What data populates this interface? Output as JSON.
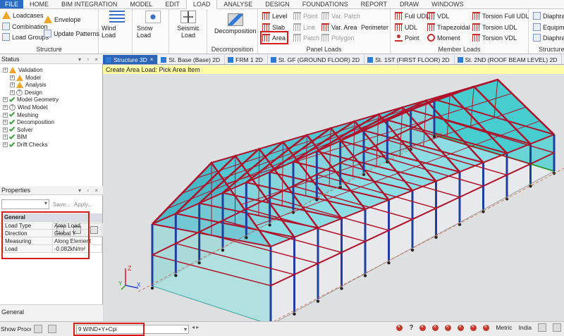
{
  "menu": [
    "FILE",
    "HOME",
    "BIM INTEGRATION",
    "MODEL",
    "EDIT",
    "LOAD",
    "ANALYSE",
    "DESIGN",
    "FOUNDATIONS",
    "REPORT",
    "DRAW",
    "WINDOWS"
  ],
  "ribbon": {
    "structure": {
      "loadcases": "Loadcases",
      "combination": "Combination",
      "load_groups": "Load Groups",
      "envelope": "Envelope",
      "update_patterns": "Update Patterns",
      "label": "Structure"
    },
    "wind_load": "Wind Load",
    "snow_load": "Snow Load",
    "seismic_load": "Seismic Load",
    "decomposition": {
      "button": "Decomposition",
      "label": "Decomposition"
    },
    "panel_loads": {
      "level": "Level",
      "slab": "Slab",
      "area": "Area",
      "point": "Point",
      "line": "Line",
      "patch": "Patch",
      "var_patch": "Var. Patch",
      "var_area": "Var. Area",
      "polygon": "Polygon",
      "perimeter": "Perimeter",
      "label": "Panel Loads"
    },
    "member_loads": {
      "full_udl": "Full UDL",
      "udl": "UDL",
      "point": "Point",
      "vdl": "VDL",
      "trapezoidal": "Trapezoidal",
      "moment": "Moment",
      "torsion_full_udl": "Torsion Full UDL",
      "torsion_udl": "Torsion UDL",
      "torsion_vdl": "Torsion VDL",
      "label": "Member Loads"
    },
    "structure_l": {
      "diaphragm": "Diaphragm",
      "equipment": "Equipment",
      "diaphragm_t": "Diaphragm T",
      "label": "Structure L"
    }
  },
  "status_panel": {
    "title": "Status",
    "items": [
      {
        "label": "Validation",
        "state": "warn",
        "level": 0
      },
      {
        "label": "Model",
        "state": "warn",
        "level": 1
      },
      {
        "label": "Analysis",
        "state": "warn",
        "level": 1
      },
      {
        "label": "Design",
        "state": "unknown",
        "level": 1
      },
      {
        "label": "Model Geometry",
        "state": "ok",
        "level": 0
      },
      {
        "label": "Wind Model",
        "state": "unknown",
        "level": 0
      },
      {
        "label": "Meshing",
        "state": "ok",
        "level": 0
      },
      {
        "label": "Decomposition",
        "state": "ok",
        "level": 0
      },
      {
        "label": "Solver",
        "state": "ok",
        "level": 0
      },
      {
        "label": "BIM",
        "state": "ok",
        "level": 0
      },
      {
        "label": "Drift Checks",
        "state": "ok",
        "level": 0
      }
    ]
  },
  "properties": {
    "title": "Properties",
    "save": "Save...",
    "apply": "Apply...",
    "section": "General",
    "rows": [
      {
        "k": "Load Type",
        "v": "Area Load"
      },
      {
        "k": "Direction",
        "v": "Global Y"
      },
      {
        "k": "Measuring",
        "v": "Along Element"
      },
      {
        "k": "Load",
        "v": "-0.082kN/m²"
      }
    ],
    "bottom_section": "General"
  },
  "tabs": [
    "Structure 3D",
    "St. Base (Base) 2D",
    "FRM 1 2D",
    "St. GF (GROUND FLOOR) 2D",
    "St. 1ST (FIRST FLOOR) 2D",
    "St. 2ND (ROOF BEAM LEVEL) 2D"
  ],
  "viewport": {
    "prompt": "Create Area Load: Pick Area Item",
    "axes": {
      "x": "X",
      "y": "Y",
      "z": "Z"
    }
  },
  "statusbar": {
    "show_process": "Show Process",
    "loadcase": "9 WIND+Y+Cpi",
    "units": "Metric",
    "region": "India"
  },
  "colors": {
    "accent": "#2b63b6",
    "highlight": "#d81b1b",
    "steel_blue": "#1f3f9e",
    "steel_red": "#b0122a",
    "glass": "#27c9c9",
    "prompt_bg": "#fffca6"
  }
}
